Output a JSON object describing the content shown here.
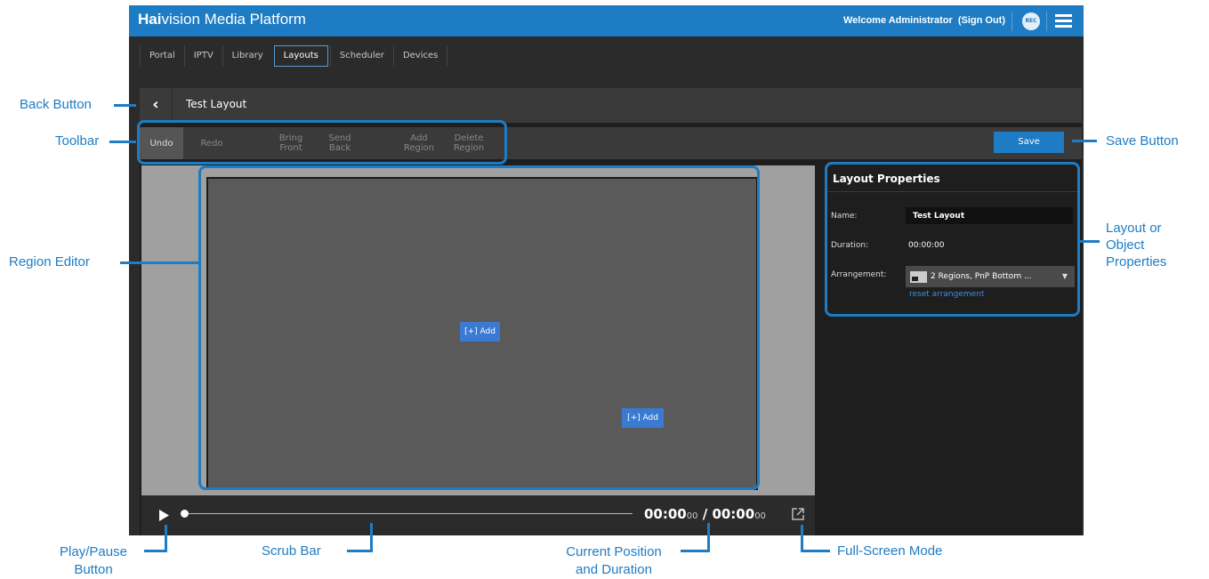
{
  "header": {
    "brand_bold": "Hai",
    "brand_rest": "vision Media Platform",
    "welcome": "Welcome Administrator",
    "sign_out": "(Sign Out)",
    "rec_label": "REC"
  },
  "nav": {
    "tabs": [
      {
        "label": "Portal"
      },
      {
        "label": "IPTV"
      },
      {
        "label": "Library"
      },
      {
        "label": "Layouts",
        "active": true
      },
      {
        "label": "Scheduler"
      },
      {
        "label": "Devices"
      }
    ]
  },
  "editor": {
    "title": "Test Layout",
    "toolbar": {
      "undo": "Undo",
      "redo": "Redo",
      "bring_front": "Bring\nFront",
      "send_back": "Send\nBack",
      "add_region": "Add\nRegion",
      "delete_region": "Delete\nRegion",
      "save": "Save"
    },
    "regions": [
      {
        "add_label": "[+] Add"
      },
      {
        "add_label": "[+] Add"
      }
    ],
    "playback": {
      "current_main": "00:00",
      "current_frames": "00",
      "separator": "/",
      "duration_main": "00:00",
      "duration_frames": "00",
      "progress": 0
    }
  },
  "properties": {
    "title": "Layout Properties",
    "name_label": "Name:",
    "name_value": "Test Layout",
    "duration_label": "Duration:",
    "duration_value": "00:00:00",
    "arrangement_label": "Arrangement:",
    "arrangement_value": "2 Regions, PnP Bottom ...",
    "reset_link": "reset arrangement"
  },
  "callouts": {
    "back_button": "Back Button",
    "toolbar": "Toolbar",
    "region_editor": "Region Editor",
    "save_button": "Save Button",
    "layout_properties_1": "Layout or",
    "layout_properties_2": "Object",
    "layout_properties_3": "Properties",
    "play_pause_1": "Play/Pause",
    "play_pause_2": "Button",
    "scrub_bar": "Scrub Bar",
    "position_1": "Current Position",
    "position_2": "and Duration",
    "full_screen": "Full-Screen Mode"
  },
  "colors": {
    "accent": "#1d7cc4",
    "app_background": "#2b2b2b",
    "add_button": "#3b7ad2"
  },
  "icons": [
    "back-chevron-icon",
    "rec-icon",
    "menu-icon",
    "play-icon",
    "full-screen-icon",
    "arrangement-thumbnail-icon",
    "caret-down-icon"
  ]
}
